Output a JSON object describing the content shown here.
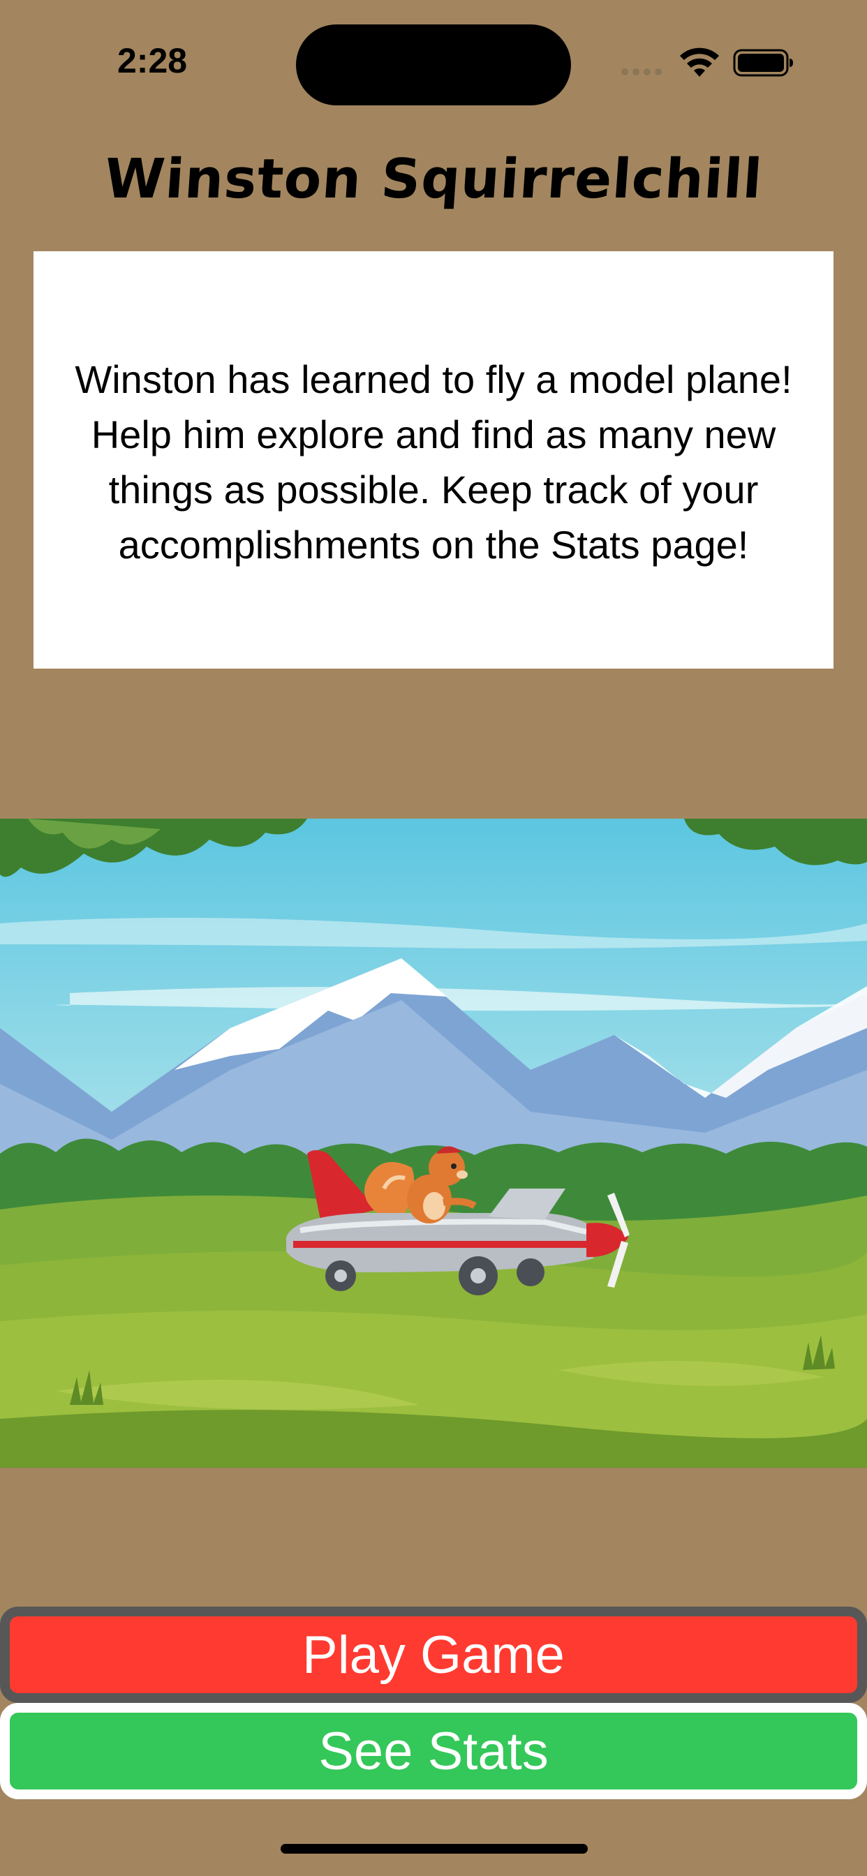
{
  "status_bar": {
    "time": "2:28"
  },
  "header": {
    "title": "Winston Squirrelchill"
  },
  "description": {
    "lines": [
      "Winston has learned to fly a model plane!",
      "Help him explore and find as many new",
      "things as possible. Keep track of your",
      "accomplishments on the Stats page!"
    ]
  },
  "hero_image": {
    "subject": "squirrel-flying-model-plane-illustration"
  },
  "actions": {
    "play_label": "Play Game",
    "stats_label": "See Stats"
  },
  "colors": {
    "background": "#a3865f",
    "play_button": "#ff3a30",
    "play_border": "#575757",
    "stats_button": "#34c759",
    "stats_border": "#ffffff",
    "card": "#ffffff"
  },
  "icons": {
    "wifi": "wifi-icon",
    "battery": "battery-icon",
    "signal": "cellular-signal-icon"
  }
}
